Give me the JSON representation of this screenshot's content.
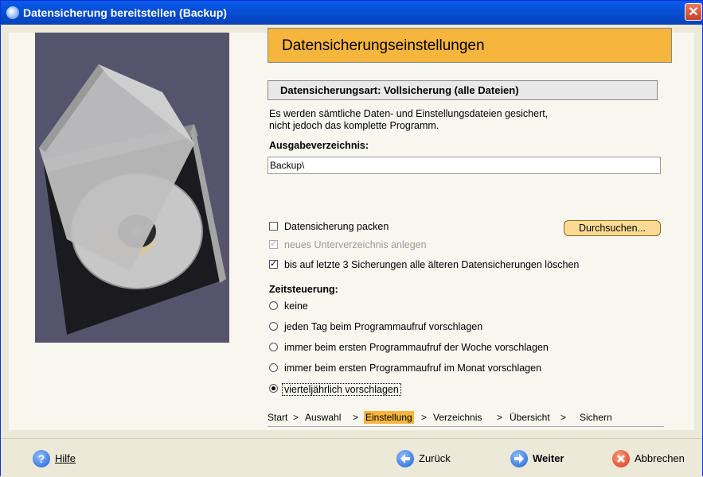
{
  "window": {
    "title": "Datensicherung bereitstellen (Backup)",
    "close_symbol": "✕"
  },
  "header": {
    "title": "Datensicherungseinstellungen"
  },
  "section": {
    "title": "Datensicherungsart: Vollsicherung (alle Dateien)"
  },
  "description": {
    "line1": "Es werden sämtliche Daten- und Einstellungsdateien gesichert,",
    "line2": "nicht jedoch das komplette Programm."
  },
  "output": {
    "label": "Ausgabeverzeichnis:",
    "value": "Backup\\"
  },
  "options": {
    "pack": {
      "label": "Datensicherung packen",
      "checked": false
    },
    "subdir": {
      "label": "neues Unterverzeichnis anlegen",
      "checked": true,
      "disabled": true
    },
    "delete_old": {
      "label": "bis auf letzte 3 Sicherungen alle älteren Datensicherungen löschen",
      "checked": true
    }
  },
  "browse_button": {
    "label": "Durchsuchen..."
  },
  "schedule": {
    "label": "Zeitsteuerung:",
    "items": [
      {
        "label": "keine",
        "checked": false
      },
      {
        "label": "jeden Tag beim Programmaufruf vorschlagen",
        "checked": false
      },
      {
        "label": "immer beim ersten Programmaufruf der Woche vorschlagen",
        "checked": false
      },
      {
        "label": "immer beim ersten Programmaufruf im Monat vorschlagen",
        "checked": false
      },
      {
        "label": "vierteljährlich vorschlagen",
        "checked": true
      }
    ]
  },
  "breadcrumb": {
    "items": [
      "Start",
      "Auswahl",
      "Einstellung",
      "Verzeichnis",
      "Übersicht",
      "Sichern"
    ],
    "separator": ">",
    "active": "Einstellung"
  },
  "footer": {
    "help": "Hilfe",
    "back": "Zurück",
    "next": "Weiter",
    "cancel": "Abbrechen"
  },
  "colors": {
    "accent": "#F6B53C",
    "titlebar": "#0A5BEB",
    "panel_bg": "#56546D"
  }
}
